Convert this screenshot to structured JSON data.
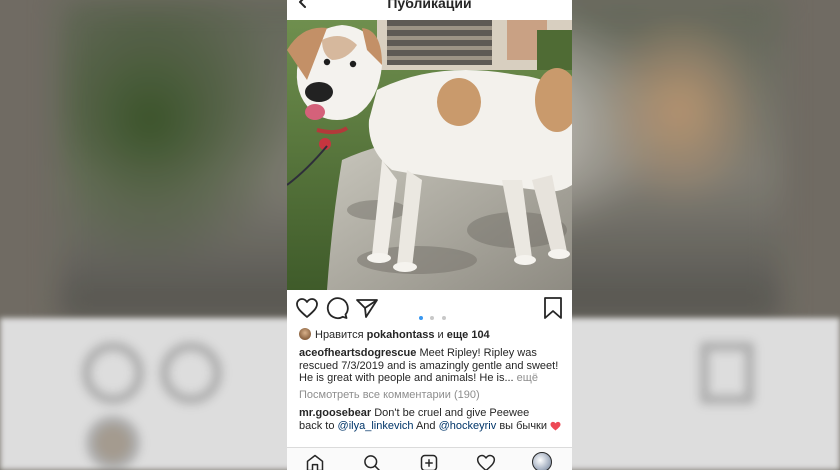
{
  "header": {
    "title": "Публикации"
  },
  "post": {
    "likes": {
      "prefix": "Нравится",
      "user": "pokahontass",
      "conj": "и",
      "rest": "еще 104"
    },
    "caption": {
      "username": "aceofheartsdogrescue",
      "text": "Meet Ripley! Ripley was rescued 7/3/2019 and is amazingly gentle and sweet! He is great with people and animals! He is...",
      "more": "ещё"
    },
    "view_all_comments": "Посмотреть все комментарии (190)",
    "comment": {
      "username": "mr.goosebear",
      "text1": "Don't be cruel and give Peewee back to",
      "mention1": "@ilya_linkevich",
      "text2": "And",
      "mention2": "@hockeyriv",
      "text3": "вы бычки"
    },
    "carousel": {
      "count": 3,
      "active": 1
    }
  },
  "icons": {
    "back": "chevron-left-icon",
    "like": "heart-icon",
    "comment": "comment-bubble-icon",
    "share": "paper-plane-icon",
    "save": "bookmark-icon",
    "home": "home-icon",
    "search": "search-icon",
    "new_post": "plus-square-icon",
    "activity": "heart-icon",
    "profile": "profile-avatar"
  },
  "colors": {
    "accent": "#3897f0",
    "liked": "#ed4956",
    "text": "#262626",
    "muted": "#8e8e8e"
  }
}
